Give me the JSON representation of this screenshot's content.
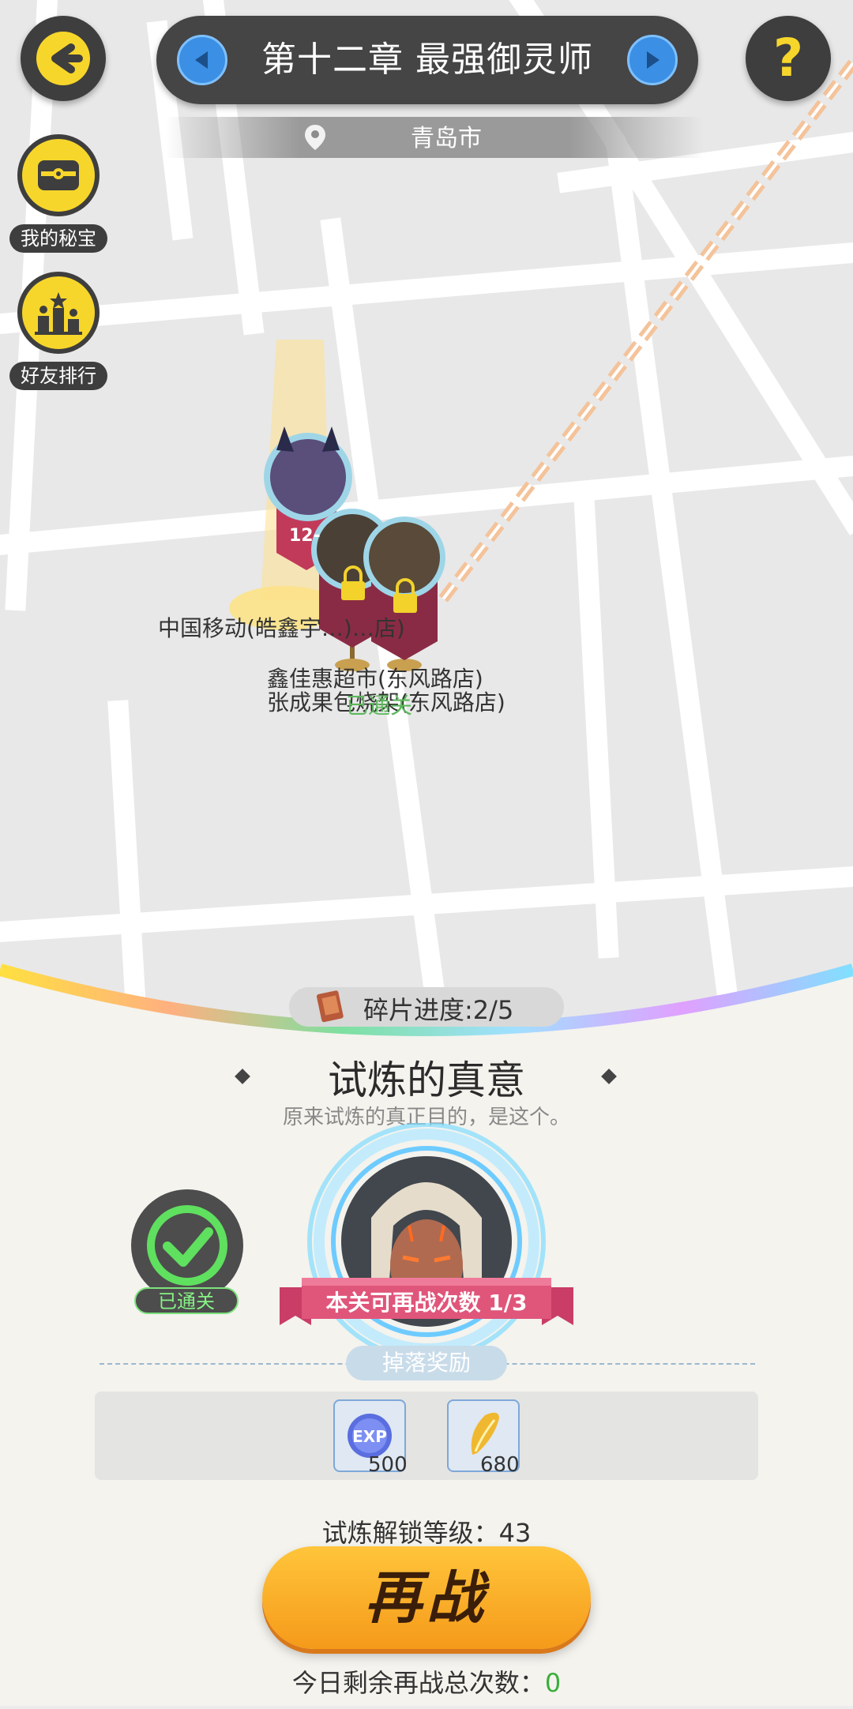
{
  "header": {
    "back_icon": "arrow-left-icon",
    "chapter_title": "第十二章 最强御灵师",
    "help_icon": "question-icon",
    "city": "青岛市"
  },
  "sidebar": {
    "items": [
      {
        "label": "我的秘宝",
        "icon": "treasure-chest-icon"
      },
      {
        "label": "好友排行",
        "icon": "podium-icon"
      }
    ]
  },
  "map": {
    "labels": [
      "中国移动(皓鑫宇…)…店)",
      "鑫佳惠超市(东风路店)",
      "张成果包烧架(东风路店)",
      "已通关"
    ],
    "pin_text": "12-"
  },
  "stage": {
    "fragment_progress_label": "碎片进度:",
    "fragment_progress_value": "2/5",
    "title": "试炼的真意",
    "description": "原来试炼的真正目的，是这个。",
    "cleared_label": "已通关",
    "retry_ribbon": "本关可再战次数 1/3"
  },
  "rewards": {
    "label": "掉落奖励",
    "items": [
      {
        "icon": "exp-orb-icon",
        "text": "EXP",
        "count": "500"
      },
      {
        "icon": "gold-feather-icon",
        "count": "680"
      }
    ]
  },
  "unlock_level_label": "试炼解锁等级：43",
  "replay_button": "再战",
  "remaining_label": "今日剩余再战总次数：",
  "remaining_value": "0",
  "colors": {
    "accent_yellow": "#f7d62b",
    "button_orange": "#f5a623",
    "ribbon_pink": "#e0557a",
    "cleared_green": "#5fd35f"
  }
}
